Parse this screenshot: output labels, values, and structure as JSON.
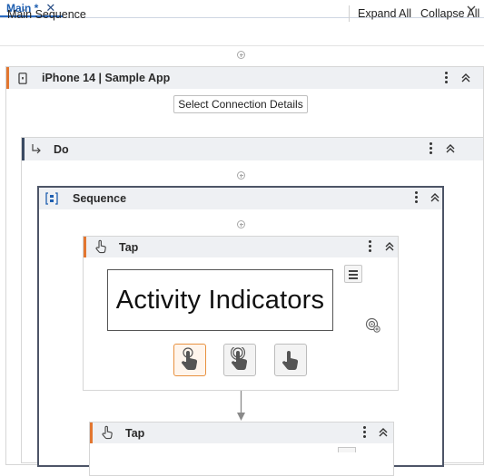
{
  "tabs": [
    {
      "label": "Main *",
      "active": true
    }
  ],
  "toolbar": {
    "title": "Main Sequence",
    "expand_label": "Expand All",
    "collapse_label": "Collapse All"
  },
  "app_card": {
    "title": "iPhone 14 | Sample App",
    "connection_button": "Select Connection Details"
  },
  "do_card": {
    "title": "Do"
  },
  "sequence_card": {
    "title": "Sequence"
  },
  "tap_cards": [
    {
      "title": "Tap",
      "image_text": "Activity Indicators"
    },
    {
      "title": "Tap"
    }
  ],
  "colors": {
    "tab_accent": "#2a6ac0",
    "orange_accent": "#e27630",
    "dark_accent": "#3a4a62",
    "header_bg": "#eef0f3"
  },
  "icons": [
    "chevron-down-icon",
    "close-icon",
    "add-circle-icon",
    "phone-icon",
    "kebab-icon",
    "double-chevron-up-icon",
    "arrow-turn-icon",
    "sequence-icon",
    "hand-tap-icon",
    "hamburger-icon",
    "target-icon"
  ]
}
